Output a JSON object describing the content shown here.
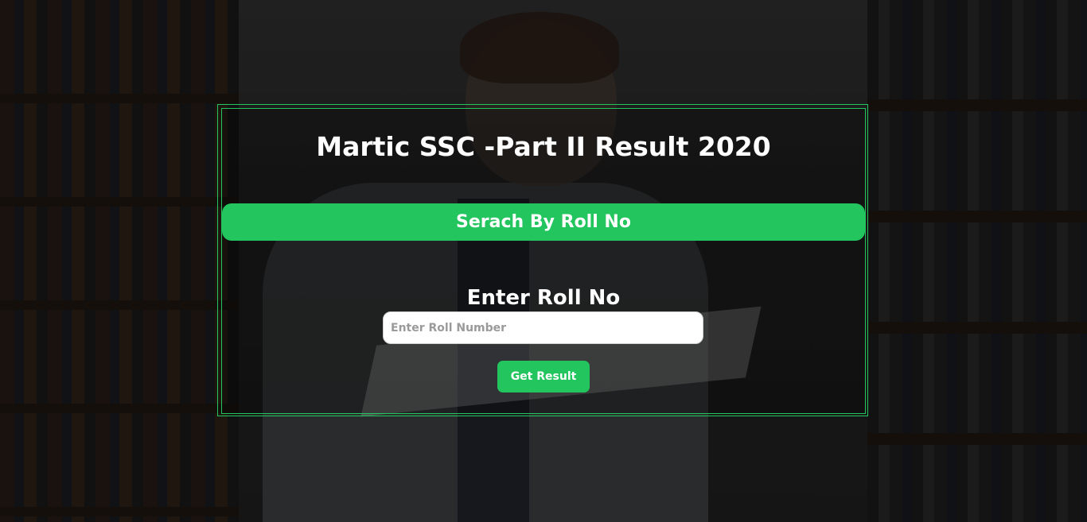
{
  "page": {
    "title": "Martic SSC -Part II Result 2020"
  },
  "search": {
    "banner": "Serach By Roll No",
    "label": "Enter Roll No",
    "input_value": "",
    "input_placeholder": "Enter Roll Number",
    "submit_label": "Get Result"
  },
  "colors": {
    "accent": "#22c55e",
    "text": "#ffffff"
  }
}
